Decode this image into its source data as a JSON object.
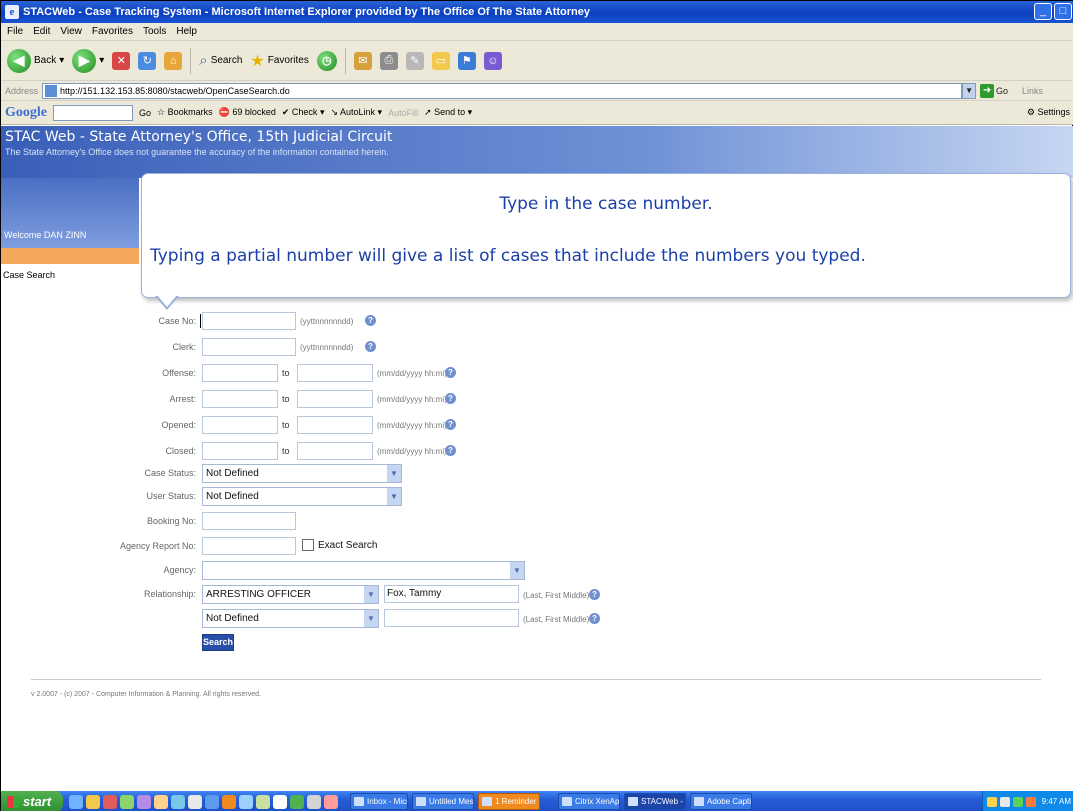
{
  "window": {
    "title": "STACWeb - Case Tracking System - Microsoft Internet Explorer provided by The Office Of The State Attorney",
    "icon": "ie-icon"
  },
  "menu": [
    "File",
    "Edit",
    "View",
    "Favorites",
    "Tools",
    "Help"
  ],
  "toolbar": {
    "back_label": "Back",
    "search_label": "Search",
    "favorites_label": "Favorites"
  },
  "address": {
    "label": "Address",
    "url": "http://151.132.153.85:8080/stacweb/OpenCaseSearch.do",
    "go_label": "Go",
    "links_label": "Links"
  },
  "google_toolbar": {
    "logo": "Google",
    "go": "Go",
    "bookmarks": "Bookmarks",
    "blocked": "69 blocked",
    "check": "Check",
    "autolink": "AutoLink",
    "autofill": "AutoFill",
    "sendto": "Send to",
    "settings": "Settings"
  },
  "banner": {
    "title": "STAC Web - State Attorney's Office, 15th Judicial Circuit",
    "disclaimer": "The State Attorney's Office does not guarantee the accuracy of the information contained herein."
  },
  "nav": {
    "welcome": "Welcome DAN ZINN",
    "case_search": "Case Search"
  },
  "callout": {
    "line1": "Type in the case number.",
    "line2": "Typing a partial number will give a list of cases that include the numbers you typed."
  },
  "form": {
    "case_no_label": "Case No:",
    "case_no_value": "",
    "case_no_hint": "(yyttnnnnnndd)",
    "clerk_label": "Clerk:",
    "clerk_hint": "(yyttnnnnnndd)",
    "offense_label": "Offense:",
    "arrest_label": "Arrest:",
    "opened_label": "Opened:",
    "closed_label": "Closed:",
    "to_label": "to",
    "date_hint": "(mm/dd/yyyy hh:mi)",
    "case_status_label": "Case Status:",
    "case_status_value": "Not Defined",
    "user_status_label": "User Status:",
    "user_status_value": "Not Defined",
    "booking_label": "Booking No:",
    "agency_report_label": "Agency Report No:",
    "exact_search_label": "Exact Search",
    "agency_label": "Agency:",
    "agency_value": "",
    "relationship_label": "Relationship:",
    "relationship_value": "ARRESTING OFFICER",
    "relationship_name": "Fox, Tammy",
    "relationship2_value": "Not Defined",
    "relationship2_name": "",
    "name_hint": "(Last, First Middle)",
    "search_button": "Search"
  },
  "footer": {
    "text": "v 2.0007 - (c) 2007 - Computer Information & Planning. All rights reserved."
  },
  "taskbar": {
    "start": "start",
    "tasks": [
      {
        "label": "Inbox - Microso...",
        "style": "normal"
      },
      {
        "label": "Untitled Message",
        "style": "normal"
      },
      {
        "label": "1 Reminder",
        "style": "orange"
      },
      {
        "label": "Citrix XenApp - ...",
        "style": "normal"
      },
      {
        "label": "STACWeb - Cas...",
        "style": "active"
      },
      {
        "label": "Adobe Captivate",
        "style": "normal"
      }
    ],
    "clock": "9:47 AM"
  }
}
